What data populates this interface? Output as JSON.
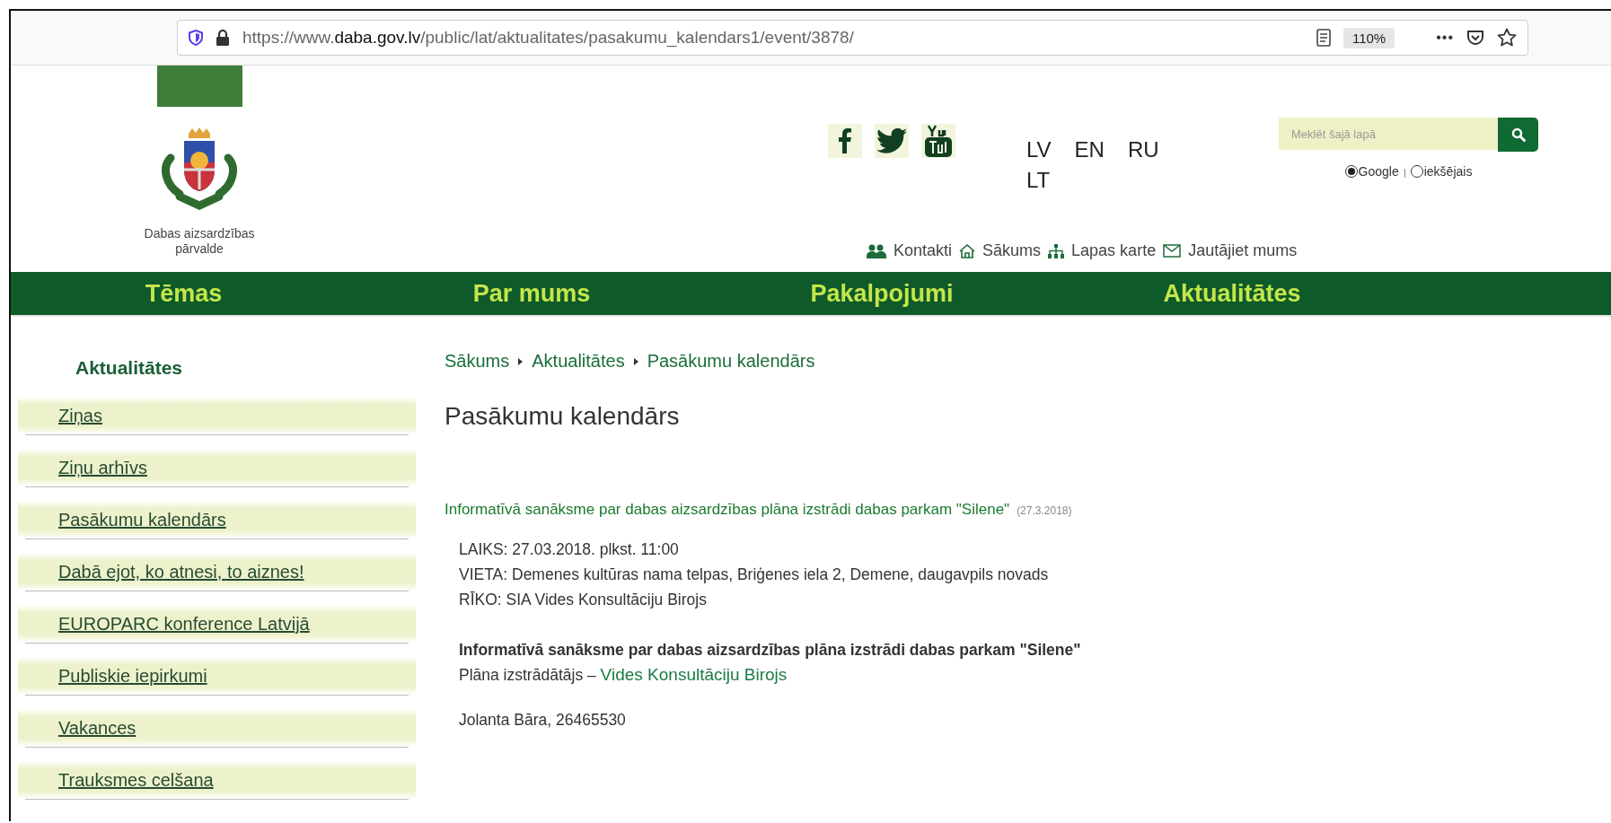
{
  "browser": {
    "url_scheme": "https://www.",
    "url_domain": "daba.gov.lv",
    "url_path": "/public/lat/aktualitates/pasakumu_kalendars1/event/3878/",
    "zoom": "110%",
    "menu": "•••"
  },
  "header": {
    "logo_caption": "Dabas aizsardzības pārvalde",
    "languages": [
      "LV",
      "EN",
      "RU",
      "LT"
    ],
    "search": {
      "placeholder": "Meklēt šajā lapā"
    },
    "search_scope": [
      {
        "label": "Google",
        "selected": true
      },
      {
        "label": "iekšējais",
        "selected": false
      }
    ],
    "utility_links": [
      {
        "kind": "people",
        "label": "Kontakti"
      },
      {
        "kind": "home",
        "label": "Sākums"
      },
      {
        "kind": "sitemap",
        "label": "Lapas karte"
      },
      {
        "kind": "mail",
        "label": "Jautājiet mums"
      }
    ]
  },
  "nav": [
    "Tēmas",
    "Par mums",
    "Pakalpojumi",
    "Aktualitātes"
  ],
  "sidebar": {
    "title": "Aktualitātes",
    "items": [
      "Ziņas",
      "Ziņu arhīvs",
      "Pasākumu kalendārs",
      "Dabā ejot, ko atnesi, to aiznes!",
      "EUROPARC konference Latvijā",
      "Publiskie iepirkumi",
      "Vakances",
      "Trauksmes celšana"
    ]
  },
  "breadcrumbs": [
    "Sākums",
    "Aktualitātes",
    "Pasākumu kalendārs"
  ],
  "page_title": "Pasākumu kalendārs",
  "event": {
    "title": "Informatīvā sanāksme par dabas aizsardzības plāna izstrādi dabas parkam \"Silene\"",
    "date": "(27.3.2018)",
    "details": [
      "LAIKS: 27.03.2018. plkst. 11:00",
      "VIETA: Demenes kultūras nama telpas, Briģenes iela 2, Demene, daugavpils novads",
      "RĪKO: SIA Vides Konsultāciju Birojs"
    ],
    "heading": "Informatīvā sanāksme par dabas aizsardzības plāna izstrādi dabas parkam \"Silene\"",
    "developer_label": "Plāna izstrādātājs –",
    "developer_link": "Vides Konsultāciju Birojs",
    "contact": "Jolanta Bāra, 26465530"
  }
}
